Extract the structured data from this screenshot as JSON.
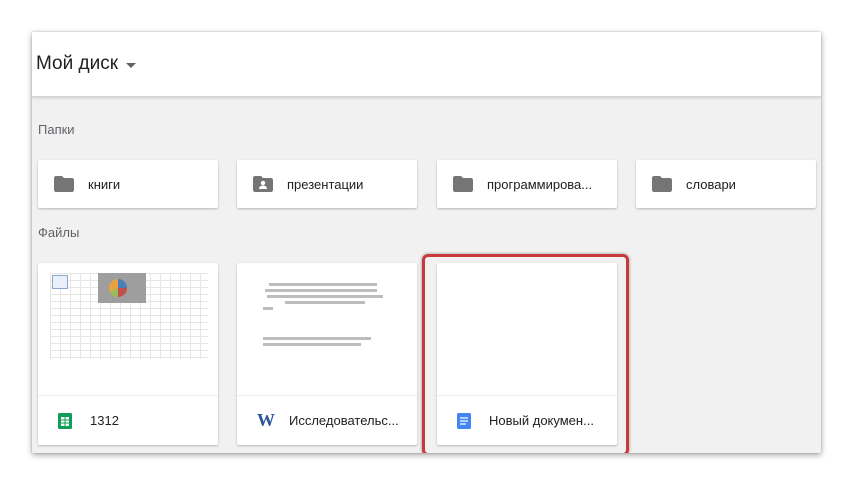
{
  "header": {
    "title": "Мой диск"
  },
  "sections": {
    "folders_label": "Папки",
    "files_label": "Файлы"
  },
  "folders": [
    {
      "label": "книги",
      "icon": "folder-icon"
    },
    {
      "label": "презентации",
      "icon": "shared-folder-icon"
    },
    {
      "label": "программирова...",
      "icon": "folder-icon"
    },
    {
      "label": "словари",
      "icon": "folder-icon"
    }
  ],
  "files": [
    {
      "label": "1312",
      "icon": "google-sheets-icon",
      "icon_color": "#0f9d58"
    },
    {
      "label": "Исследовательс...",
      "icon": "word-icon",
      "icon_color": "#2a5699"
    },
    {
      "label": "Новый докумен...",
      "icon": "google-docs-icon",
      "icon_color": "#4285f4"
    }
  ],
  "colors": {
    "highlight": "#c9393c",
    "background": "#f1f1f1"
  }
}
